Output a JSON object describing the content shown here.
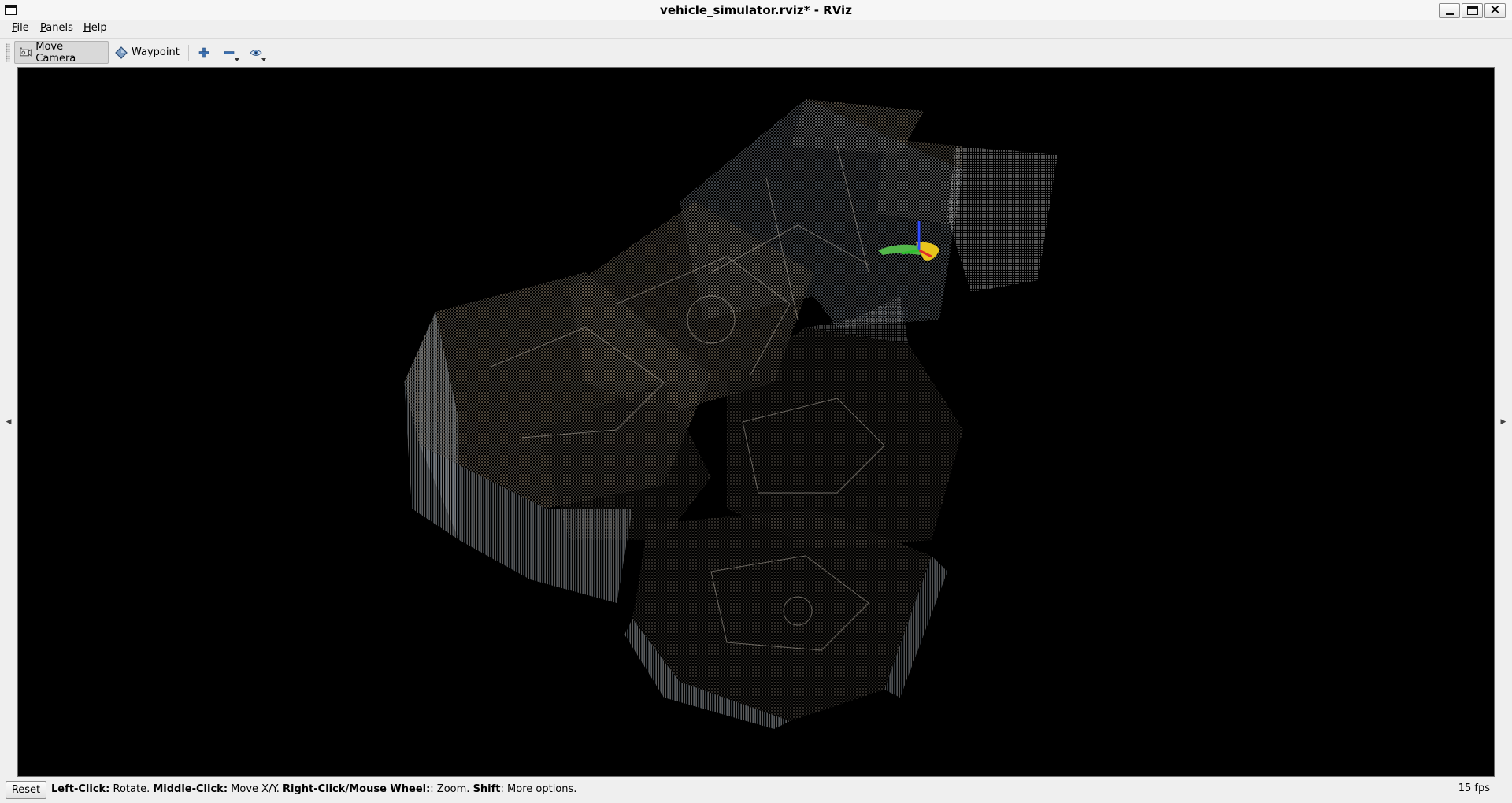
{
  "window": {
    "title": "vehicle_simulator.rviz* - RViz",
    "app_icon": "window-icon",
    "controls": [
      "minimize",
      "maximize",
      "close"
    ]
  },
  "menubar": {
    "items": [
      {
        "label": "File",
        "mnemonic": "F",
        "rest": "ile"
      },
      {
        "label": "Panels",
        "mnemonic": "P",
        "rest": "anels"
      },
      {
        "label": "Help",
        "mnemonic": "H",
        "rest": "elp"
      }
    ]
  },
  "toolbar": {
    "tools": [
      {
        "label": "Move Camera",
        "icon": "move-camera-icon",
        "active": true
      },
      {
        "label": "Waypoint",
        "icon": "waypoint-diamond-icon",
        "active": false
      }
    ],
    "icon_buttons": [
      "add-tool-icon",
      "remove-tool-icon",
      "view-eye-icon"
    ]
  },
  "viewport": {
    "background": "#000000",
    "content": "3d point cloud render"
  },
  "statusbar": {
    "reset_label": "Reset",
    "hint": [
      {
        "key": "Left-Click:",
        "text": " Rotate. "
      },
      {
        "key": "Middle-Click:",
        "text": " Move X/Y. "
      },
      {
        "key": "Right-Click/Mouse Wheel:",
        "text": ": Zoom. "
      },
      {
        "key": "Shift",
        "text": ": More options."
      }
    ],
    "fps": "15 fps"
  },
  "colors": {
    "accent": "#3a6fb0",
    "pointcloud_warm": "#c8b49a",
    "pointcloud_cool": "#9fb6cc"
  }
}
